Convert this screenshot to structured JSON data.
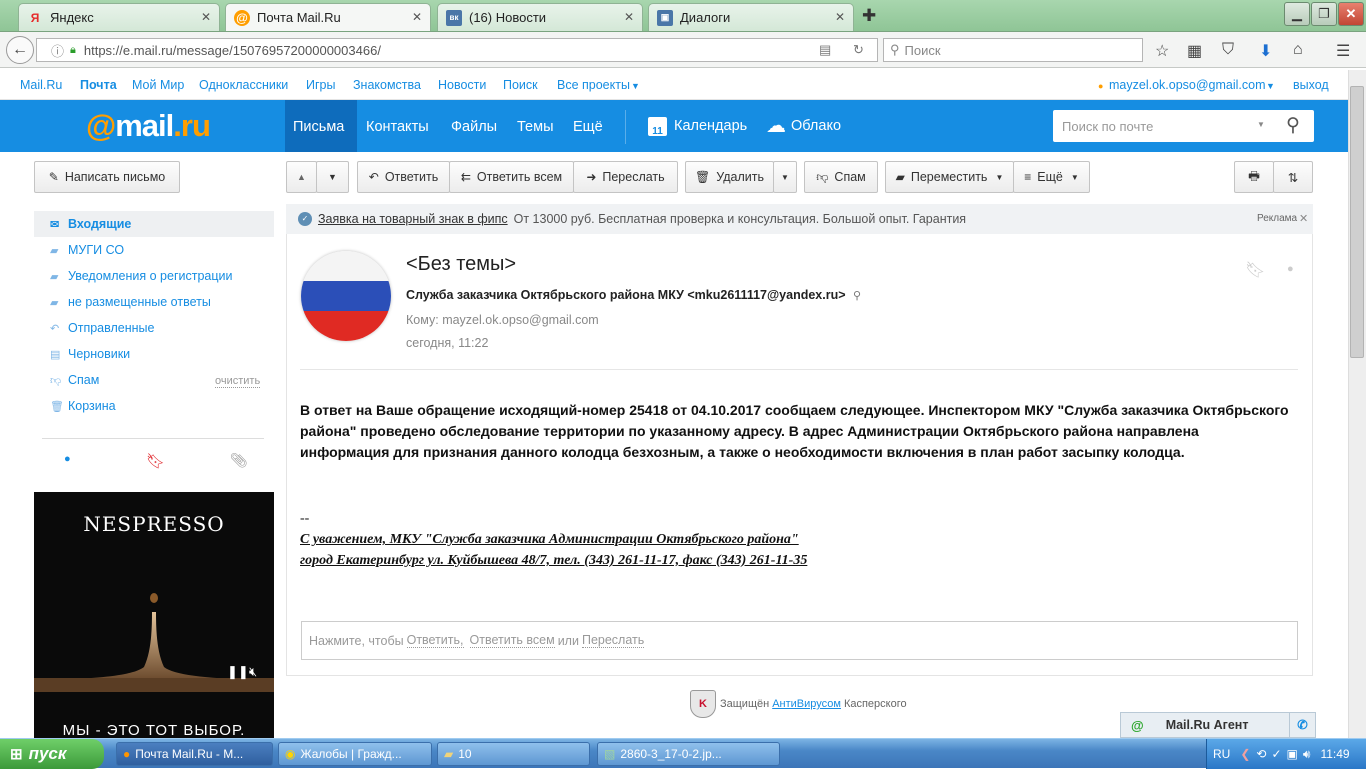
{
  "browser": {
    "tabs": [
      {
        "label": "Яндекс",
        "icon": "Я"
      },
      {
        "label": "Почта Mail.Ru",
        "icon": "@"
      },
      {
        "label": "(16) Новости",
        "icon": "вк"
      },
      {
        "label": "Диалоги",
        "icon": "▣"
      }
    ],
    "url": "https://e.mail.ru/message/15076957200000003466/",
    "search_placeholder": "Поиск"
  },
  "toplinks": {
    "items": [
      "Mail.Ru",
      "Почта",
      "Мой Мир",
      "Одноклассники",
      "Игры",
      "Знакомства",
      "Новости",
      "Поиск",
      "Все проекты"
    ],
    "account": "mayzel.ok.opso@gmail.com",
    "logout": "выход"
  },
  "header": {
    "logo_at": "@",
    "logo_mail": "mail",
    "logo_ru": ".ru",
    "nav": [
      "Письма",
      "Контакты",
      "Файлы",
      "Темы",
      "Ещё"
    ],
    "calendar": "Календарь",
    "calendar_day": "11",
    "cloud": "Облако",
    "search_placeholder": "Поиск по почте"
  },
  "toolbar": {
    "compose": "Написать письмо",
    "reply": "Ответить",
    "reply_all": "Ответить всем",
    "forward": "Переслать",
    "delete": "Удалить",
    "spam": "Спам",
    "move": "Переместить",
    "more": "Ещё"
  },
  "sidebar": {
    "folders": [
      {
        "label": "Входящие",
        "icon": "inbox-icon"
      },
      {
        "label": "МУГИ СО",
        "icon": "folder-icon"
      },
      {
        "label": "Уведомления о регистрации",
        "icon": "folder-icon"
      },
      {
        "label": "не размещенные ответы",
        "icon": "folder-icon"
      },
      {
        "label": "Отправленные",
        "icon": "sent-icon"
      },
      {
        "label": "Черновики",
        "icon": "drafts-icon"
      },
      {
        "label": "Спам",
        "icon": "spam-icon"
      },
      {
        "label": "Корзина",
        "icon": "trash-icon"
      }
    ],
    "clean": "очистить"
  },
  "ad": {
    "brand": "NESPRESSO",
    "tagline": "МЫ - ЭТО ТОТ ВЫБОР."
  },
  "adline": {
    "link": "Заявка на товарный знак в фипс",
    "text": "От 13000 руб. Бесплатная проверка и консультация. Большой опыт. Гарантия",
    "label": "Реклама"
  },
  "message": {
    "subject": "<Без темы>",
    "from": "Служба заказчика Октябрьского района МКУ <mku2611117@yandex.ru>",
    "to_label": "Кому:",
    "to": "mayzel.ok.opso@gmail.com",
    "date": "сегодня, 11:22",
    "body": "В ответ на Ваше обращение исходящий-номер 25418 от 04.10.2017 сообщаем следующее. Инспектором МКУ \"Служба заказчика Октябрьского района\" проведено обследование территории по указанному адресу. В адрес Администрации Октябрьского района направлена информация для признания данного колодца безхозным, а также о необходимости включения в план работ засыпку колодца.",
    "sig_dash": "--",
    "sig_line1": "С уважением, МКУ \"Служба заказчика Администрации Октябрьского района\"",
    "sig_line2": "город Екатеринбург ул. Куйбышева 48/7, тел. (343) 261-11-17, факс (343) 261-11-35"
  },
  "reply_box": {
    "prefix": "Нажмите, чтобы",
    "reply": "Ответить,",
    "reply_all": "Ответить всем",
    "or": "или",
    "forward": "Переслать"
  },
  "kaspersky": {
    "prefix": "Защищён",
    "link": "АнтиВирусом",
    "suffix": "Касперского"
  },
  "agent": {
    "label": "Mail.Ru Агент"
  },
  "taskbar": {
    "start": "пуск",
    "tasks": [
      "Почта Mail.Ru - М...",
      "Жалобы | Гражд...",
      "10",
      "2860-3_17-0-2.jp..."
    ],
    "lang": "RU",
    "time": "11:49"
  },
  "colors": {
    "brand_blue": "#168de2",
    "brand_orange": "#ff9e00",
    "active_nav": "#0e6cbc"
  }
}
